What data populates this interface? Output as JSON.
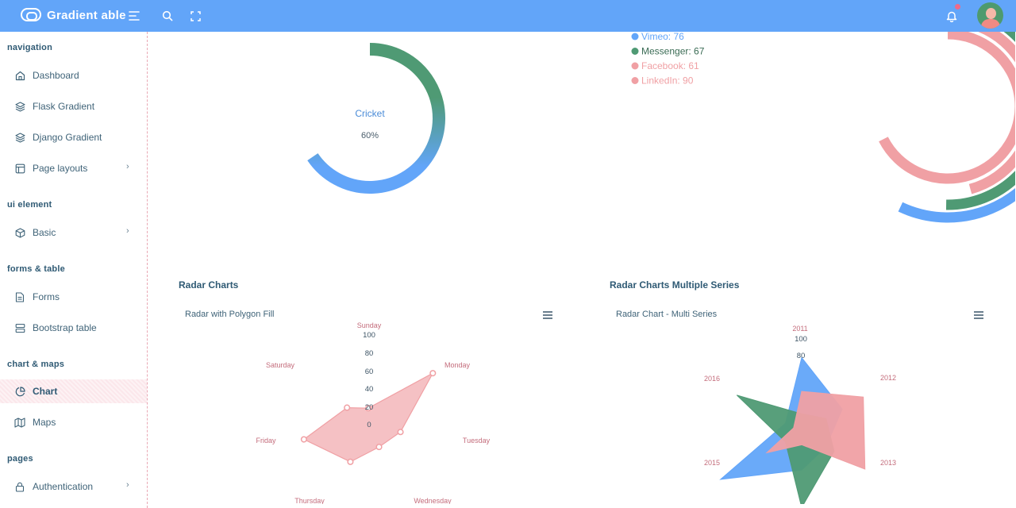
{
  "app": {
    "brand": "Gradient able"
  },
  "header": {
    "icons": [
      "menu-icon",
      "search-icon",
      "fullscreen-icon",
      "bell-icon",
      "avatar"
    ]
  },
  "sidebar": {
    "captions": [
      "navigation",
      "ui element",
      "forms & table",
      "chart & maps",
      "pages"
    ],
    "items": [
      {
        "label": "Dashboard",
        "icon": "home-icon"
      },
      {
        "label": "Flask Gradient",
        "icon": "layers-icon"
      },
      {
        "label": "Django Gradient",
        "icon": "layers-icon"
      },
      {
        "label": "Page layouts",
        "icon": "layout-icon",
        "has_children": true
      },
      {
        "label": "Basic",
        "icon": "box-icon",
        "has_children": true
      },
      {
        "label": "Forms",
        "icon": "file-text-icon"
      },
      {
        "label": "Bootstrap table",
        "icon": "server-icon"
      },
      {
        "label": "Chart",
        "icon": "pie-chart-icon",
        "active": true
      },
      {
        "label": "Maps",
        "icon": "map-icon"
      },
      {
        "label": "Authentication",
        "icon": "lock-icon",
        "has_children": true
      }
    ]
  },
  "colors": {
    "accent": "#62a5f9",
    "green": "#4f9a74",
    "pink": "#f0a0a4"
  },
  "radial_single": {
    "label": "Cricket",
    "value_text": "60%"
  },
  "radial_multi": {
    "legend": [
      "Vimeo: 76",
      "Messenger: 67",
      "Facebook: 61",
      "LinkedIn: 90"
    ]
  },
  "radar_section": {
    "title": "Radar Charts",
    "card_title": "Radar with Polygon Fill"
  },
  "radar_multi_section": {
    "title": "Radar Charts Multiple Series",
    "card_title": "Radar Chart - Multi Series"
  },
  "chart_data": [
    {
      "type": "radialBar",
      "categories": [
        "Cricket"
      ],
      "values": [
        60
      ],
      "colors": [
        "#62a5f9",
        "#4f9a74"
      ]
    },
    {
      "type": "radialBar",
      "categories": [
        "Vimeo",
        "Messenger",
        "Facebook",
        "LinkedIn"
      ],
      "values": [
        76,
        67,
        61,
        90
      ],
      "colors": [
        "#62a5f9",
        "#4f9a74",
        "#f0a0a4",
        "#f0a0a4"
      ]
    },
    {
      "type": "radar",
      "title": "Radar with Polygon Fill",
      "categories": [
        "Sunday",
        "Monday",
        "Tuesday",
        "Wednesday",
        "Thursday",
        "Friday",
        "Saturday"
      ],
      "values": [
        20,
        100,
        40,
        30,
        50,
        80,
        33
      ],
      "ticks": [
        "100",
        "80",
        "60",
        "40",
        "20",
        "0"
      ],
      "ylim": [
        0,
        100
      ],
      "color": "#f0a0a4"
    },
    {
      "type": "radar",
      "title": "Radar Chart - Multi Series",
      "categories": [
        "2011",
        "2012",
        "2013",
        "2014",
        "2015",
        "2016"
      ],
      "ticks": [
        "100",
        "80"
      ],
      "ylim": [
        0,
        100
      ],
      "series": [
        {
          "values": [
            80,
            50,
            30,
            40,
            100,
            20
          ],
          "color": "#62a5f9"
        },
        {
          "values": [
            20,
            30,
            40,
            80,
            20,
            80
          ],
          "color": "#4f9a74"
        },
        {
          "values": [
            44,
            76,
            78,
            13,
            43,
            10
          ],
          "color": "#f0a0a4"
        }
      ]
    }
  ]
}
